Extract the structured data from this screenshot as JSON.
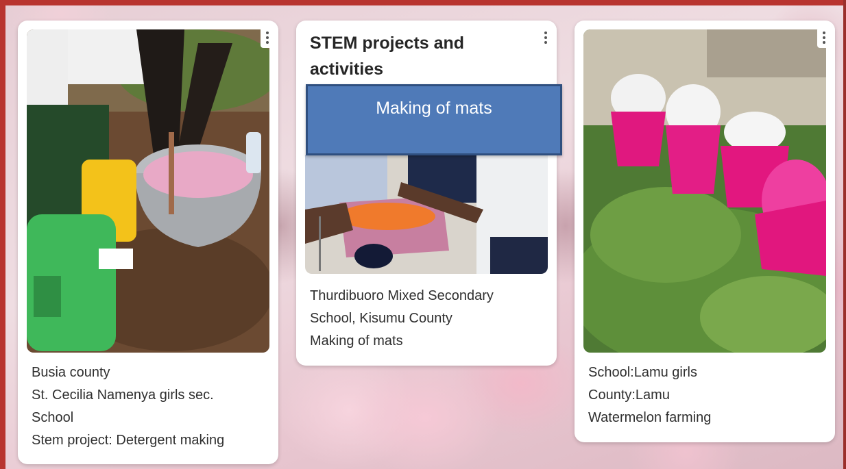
{
  "card_1": {
    "caption_lines": [
      "Busia county",
      "St. Cecilia Namenya girls sec.",
      "School",
      "Stem project: Detergent making"
    ]
  },
  "card_2": {
    "title": "STEM projects and activities",
    "caption_lines": [
      "Thurdibuoro Mixed Secondary",
      "School, Kisumu County",
      "Making of mats"
    ]
  },
  "card_3": {
    "caption_lines": [
      "School:Lamu girls",
      "County:Lamu",
      "Watermelon farming"
    ]
  },
  "banner": {
    "text": "Making of mats"
  },
  "colors": {
    "frame": "#b8342f",
    "banner_fill": "#4f7ab8",
    "banner_border": "#2f4f7f",
    "card_background": "#ffffff"
  },
  "icons": {
    "card_menu": "more-vertical-icon"
  }
}
